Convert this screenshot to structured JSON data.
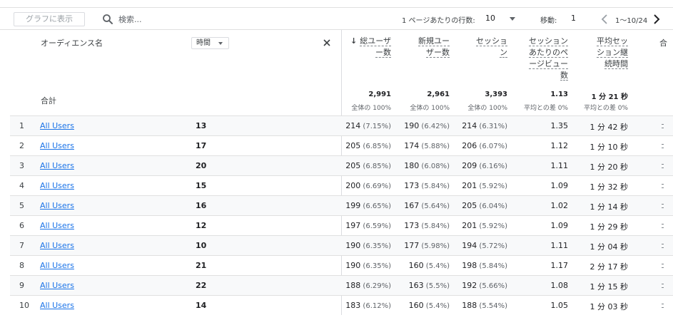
{
  "toolbar": {
    "graph_button": "グラフに表示",
    "search_placeholder": "検索...",
    "rows_per_page_label": "1 ページあたりの行数:",
    "rows_per_page_value": "10",
    "goto_label": "移動:",
    "goto_value": "1",
    "range_label": "1〜10/24"
  },
  "header": {
    "dimension": "オーディエンス名",
    "secondary_dimension": "時間",
    "metrics": [
      {
        "lines": [
          "総ユーザ",
          "ー数"
        ],
        "sorted": true
      },
      {
        "lines": [
          "新規ユー",
          "ザー数"
        ],
        "sorted": false
      },
      {
        "lines": [
          "セッショ",
          "ン"
        ],
        "sorted": false
      },
      {
        "lines": [
          "セッション",
          "あたりのペ",
          "ージビュー",
          "数"
        ],
        "sorted": false
      },
      {
        "lines": [
          "平均セッ",
          "ション継",
          "続時間"
        ],
        "sorted": false
      }
    ],
    "partial_column": "合",
    "sort_arrow": "↓"
  },
  "totals": {
    "label": "合計",
    "values": [
      "2,991",
      "2,961",
      "3,393",
      "1.13",
      "1 分 21 秒"
    ],
    "subs": [
      "全体の 100%",
      "全体の 100%",
      "全体の 100%",
      "平均との差 0%",
      "平均との差 0%"
    ]
  },
  "rows": [
    {
      "idx": "1",
      "audience": "All Users",
      "hour": "13",
      "users": "214",
      "users_pct": "(7.15%)",
      "new": "190",
      "new_pct": "(6.42%)",
      "sessions": "214",
      "sessions_pct": "(6.31%)",
      "ppv": "1.35",
      "dur": "1 分 42 秒"
    },
    {
      "idx": "2",
      "audience": "All Users",
      "hour": "17",
      "users": "205",
      "users_pct": "(6.85%)",
      "new": "174",
      "new_pct": "(5.88%)",
      "sessions": "206",
      "sessions_pct": "(6.07%)",
      "ppv": "1.12",
      "dur": "1 分 10 秒"
    },
    {
      "idx": "3",
      "audience": "All Users",
      "hour": "20",
      "users": "205",
      "users_pct": "(6.85%)",
      "new": "180",
      "new_pct": "(6.08%)",
      "sessions": "209",
      "sessions_pct": "(6.16%)",
      "ppv": "1.11",
      "dur": "1 分 20 秒"
    },
    {
      "idx": "4",
      "audience": "All Users",
      "hour": "15",
      "users": "200",
      "users_pct": "(6.69%)",
      "new": "173",
      "new_pct": "(5.84%)",
      "sessions": "201",
      "sessions_pct": "(5.92%)",
      "ppv": "1.09",
      "dur": "1 分 32 秒"
    },
    {
      "idx": "5",
      "audience": "All Users",
      "hour": "16",
      "users": "199",
      "users_pct": "(6.65%)",
      "new": "167",
      "new_pct": "(5.64%)",
      "sessions": "205",
      "sessions_pct": "(6.04%)",
      "ppv": "1.02",
      "dur": "1 分 14 秒"
    },
    {
      "idx": "6",
      "audience": "All Users",
      "hour": "12",
      "users": "197",
      "users_pct": "(6.59%)",
      "new": "173",
      "new_pct": "(5.84%)",
      "sessions": "201",
      "sessions_pct": "(5.92%)",
      "ppv": "1.09",
      "dur": "1 分 29 秒"
    },
    {
      "idx": "7",
      "audience": "All Users",
      "hour": "10",
      "users": "190",
      "users_pct": "(6.35%)",
      "new": "177",
      "new_pct": "(5.98%)",
      "sessions": "194",
      "sessions_pct": "(5.72%)",
      "ppv": "1.11",
      "dur": "1 分 04 秒"
    },
    {
      "idx": "8",
      "audience": "All Users",
      "hour": "21",
      "users": "190",
      "users_pct": "(6.35%)",
      "new": "160",
      "new_pct": "(5.4%)",
      "sessions": "198",
      "sessions_pct": "(5.84%)",
      "ppv": "1.17",
      "dur": "2 分 17 秒"
    },
    {
      "idx": "9",
      "audience": "All Users",
      "hour": "22",
      "users": "188",
      "users_pct": "(6.29%)",
      "new": "163",
      "new_pct": "(5.5%)",
      "sessions": "192",
      "sessions_pct": "(5.66%)",
      "ppv": "1.08",
      "dur": "1 分 15 秒"
    },
    {
      "idx": "10",
      "audience": "All Users",
      "hour": "14",
      "users": "183",
      "users_pct": "(6.12%)",
      "new": "160",
      "new_pct": "(5.4%)",
      "sessions": "188",
      "sessions_pct": "(5.54%)",
      "ppv": "1.05",
      "dur": "1 分 03 秒"
    }
  ],
  "colors": {
    "link": "#1a73e8",
    "border": "#e0e0e0",
    "shaded_row": "#f8f9fa"
  },
  "icons": {
    "search": "search-icon",
    "close": "close-icon",
    "prev": "chevron-left-icon",
    "next": "chevron-right-icon",
    "dropdown": "caret-down-icon"
  }
}
